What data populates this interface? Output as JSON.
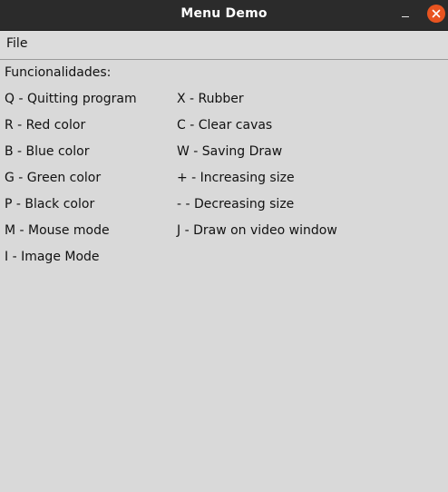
{
  "window": {
    "title": "Menu Demo"
  },
  "menubar": {
    "file_label": "File"
  },
  "content": {
    "heading": "Funcionalidades:",
    "left_column": [
      "Q - Quitting program",
      "R - Red color",
      "B - Blue color",
      "G - Green color",
      "P - Black color",
      "M - Mouse mode",
      "I - Image Mode"
    ],
    "right_column": [
      "X - Rubber",
      "C - Clear cavas",
      "W - Saving Draw",
      "+ - Increasing size",
      "- - Decreasing size",
      "J - Draw on video window"
    ]
  },
  "colors": {
    "titlebar": "#2b2b2b",
    "close_button": "#e95420",
    "background": "#d9d9d9"
  }
}
